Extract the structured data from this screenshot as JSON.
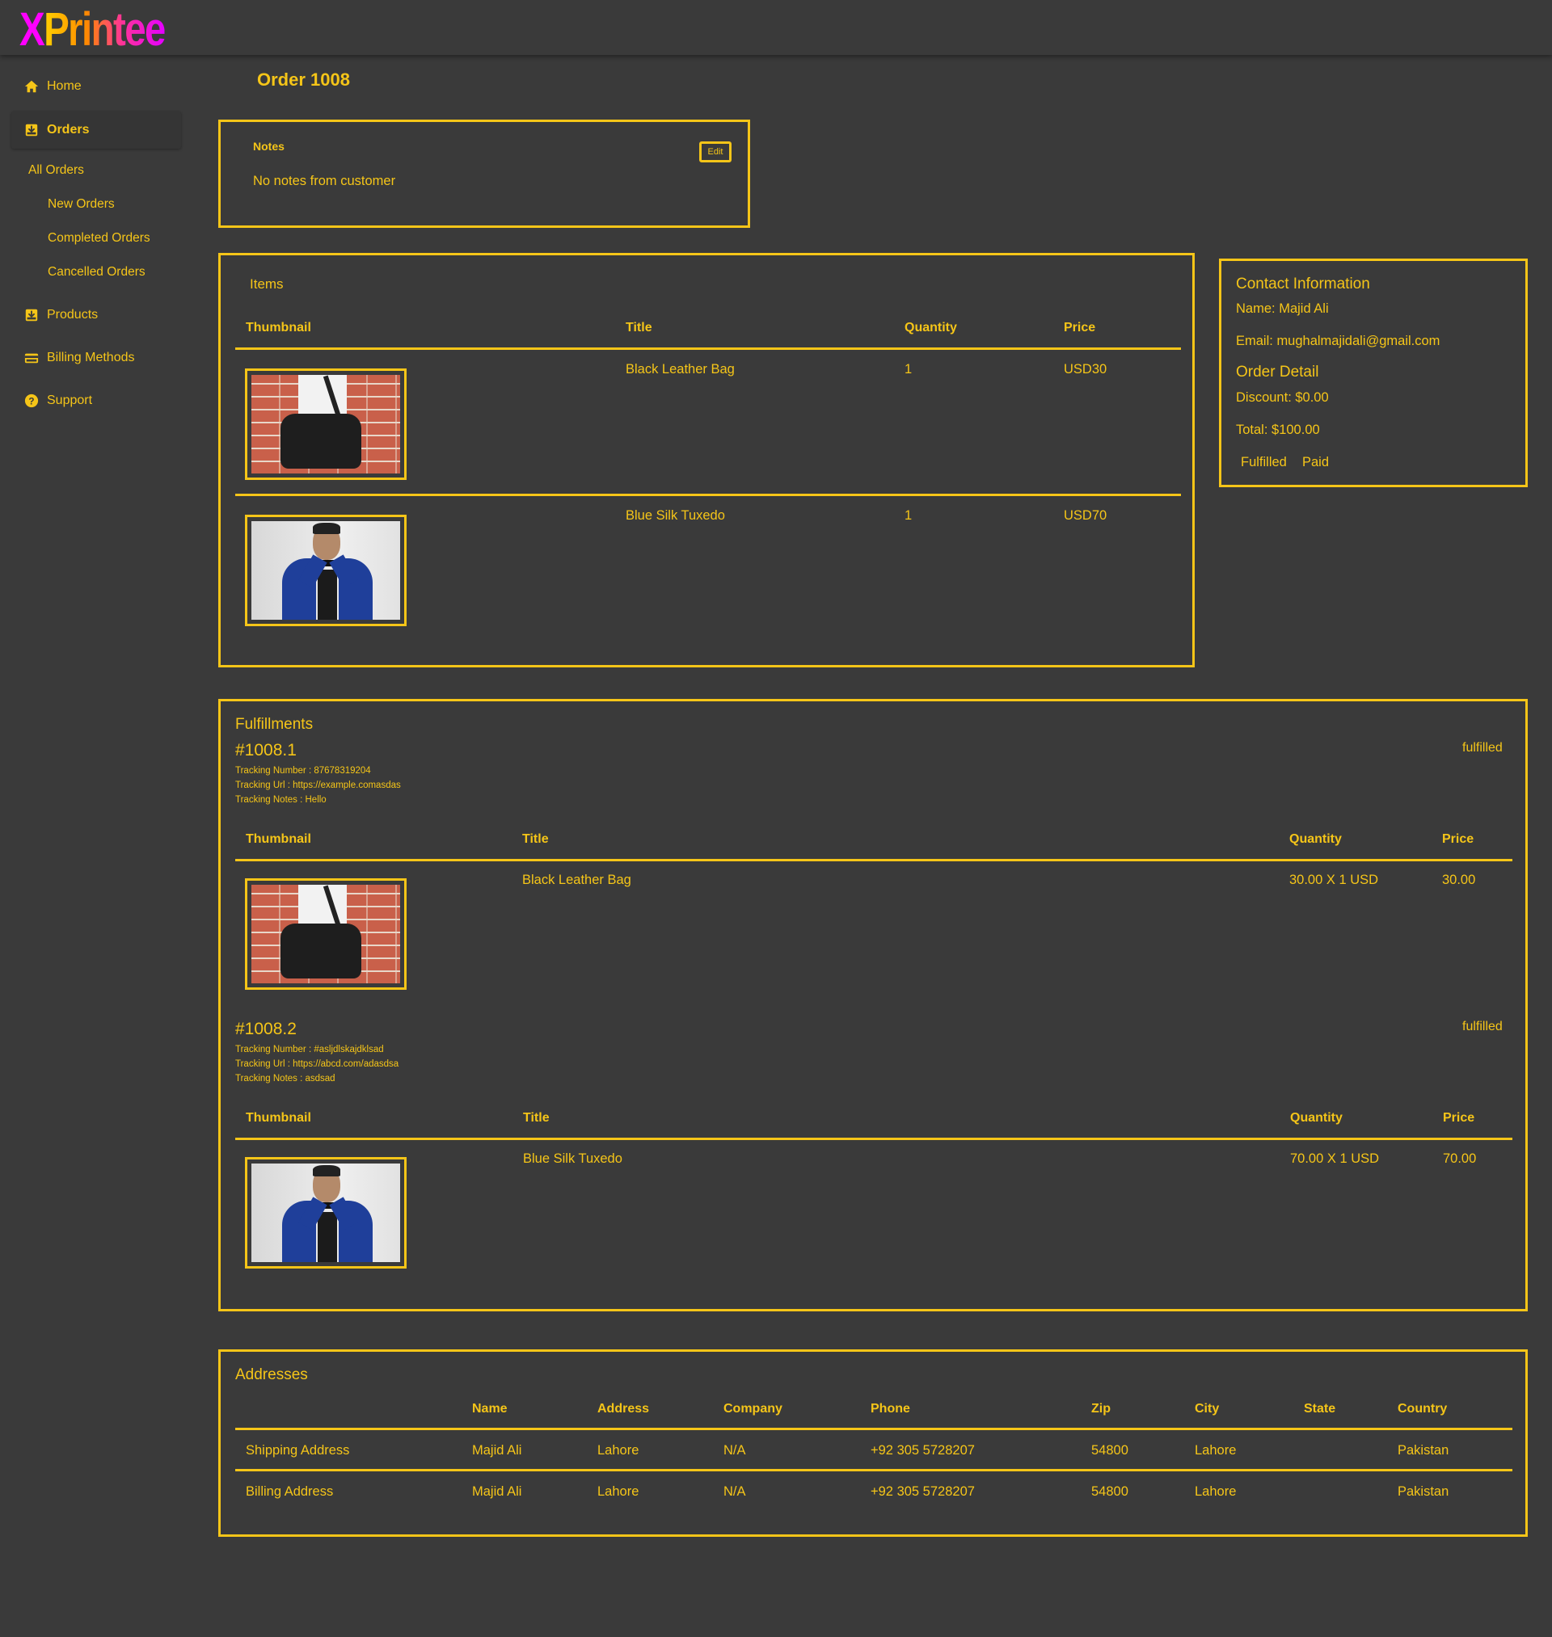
{
  "brand": {
    "logo_x": "X",
    "logo_rest": "Printee"
  },
  "sidebar": {
    "home": "Home",
    "orders": "Orders",
    "all_orders": "All Orders",
    "new_orders": "New Orders",
    "completed_orders": "Completed Orders",
    "cancelled_orders": "Cancelled Orders",
    "products": "Products",
    "billing_methods": "Billing Methods",
    "support": "Support"
  },
  "page": {
    "title": "Order 1008"
  },
  "notes": {
    "label": "Notes",
    "text": "No notes from customer",
    "edit_label": "Edit"
  },
  "items": {
    "title": "Items",
    "headers": [
      "Thumbnail",
      "Title",
      "Quantity",
      "Price"
    ],
    "rows": [
      {
        "title": "Black Leather Bag",
        "quantity": "1",
        "price": "USD30",
        "thumb": "black-leather-bag-photo"
      },
      {
        "title": "Blue Silk Tuxedo",
        "quantity": "1",
        "price": "USD70",
        "thumb": "blue-silk-tuxedo-photo"
      }
    ]
  },
  "contact": {
    "title": "Contact Information",
    "name_label": "Name:",
    "name": "Majid Ali",
    "email_label": "Email:",
    "email": "mughalmajidali@gmail.com",
    "order_detail_title": "Order Detail",
    "discount_label": "Discount:",
    "discount": "$0.00",
    "total_label": "Total:",
    "total": "$100.00",
    "status_fulfilled": "Fulfilled",
    "status_paid": "Paid"
  },
  "fulfillments": {
    "title": "Fulfillments",
    "headers": [
      "Thumbnail",
      "Title",
      "Quantity",
      "Price"
    ],
    "list": [
      {
        "id": "#1008.1",
        "status": "fulfilled",
        "tracking_number": "Tracking Number : 87678319204",
        "tracking_url": "Tracking Url : https://example.comasdas",
        "tracking_notes": "Tracking Notes : Hello",
        "item": {
          "title": "Black Leather Bag",
          "quantity": "30.00 X 1 USD",
          "price": "30.00"
        }
      },
      {
        "id": "#1008.2",
        "status": "fulfilled",
        "tracking_number": "Tracking Number : #asljdlskajdklsad",
        "tracking_url": "Tracking Url : https://abcd.com/adasdsa",
        "tracking_notes": "Tracking Notes : asdsad",
        "item": {
          "title": "Blue Silk Tuxedo",
          "quantity": "70.00 X 1 USD",
          "price": "70.00"
        }
      }
    ]
  },
  "addresses": {
    "title": "Addresses",
    "headers": [
      "Name",
      "Address",
      "Company",
      "Phone",
      "Zip",
      "City",
      "State",
      "Country"
    ],
    "rows": [
      {
        "type": "Shipping Address",
        "name": "Majid Ali",
        "address": "Lahore",
        "company": "N/A",
        "phone": "+92 305 5728207",
        "zip": "54800",
        "city": "Lahore",
        "state": "",
        "country": "Pakistan"
      },
      {
        "type": "Billing Address",
        "name": "Majid Ali",
        "address": "Lahore",
        "company": "N/A",
        "phone": "+92 305 5728207",
        "zip": "54800",
        "city": "Lahore",
        "state": "",
        "country": "Pakistan"
      }
    ]
  },
  "colors": {
    "accent": "#f5c518",
    "background": "#3a3a3a",
    "logo_x": "#ff00ff"
  }
}
